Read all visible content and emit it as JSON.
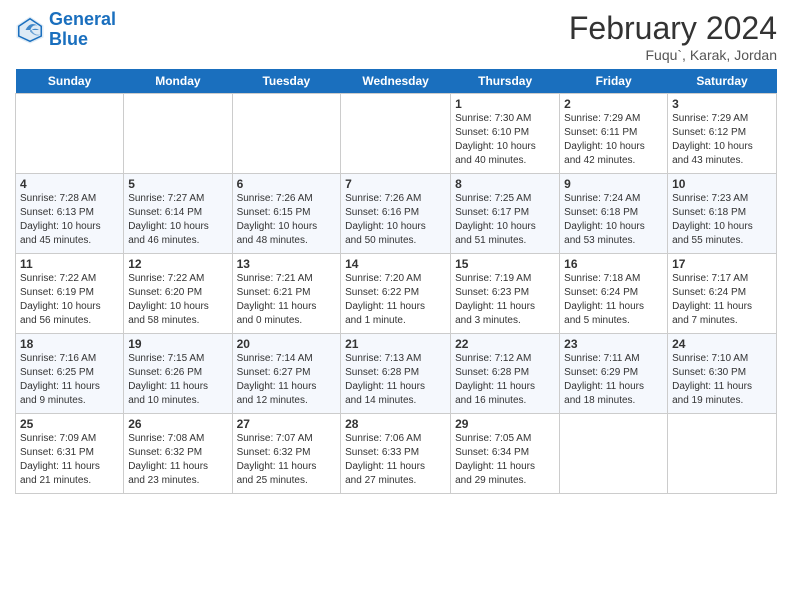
{
  "logo": {
    "line1": "General",
    "line2": "Blue"
  },
  "title": "February 2024",
  "location": "Fuqu`, Karak, Jordan",
  "days_header": [
    "Sunday",
    "Monday",
    "Tuesday",
    "Wednesday",
    "Thursday",
    "Friday",
    "Saturday"
  ],
  "weeks": [
    [
      {
        "day": "",
        "info": ""
      },
      {
        "day": "",
        "info": ""
      },
      {
        "day": "",
        "info": ""
      },
      {
        "day": "",
        "info": ""
      },
      {
        "day": "1",
        "info": "Sunrise: 7:30 AM\nSunset: 6:10 PM\nDaylight: 10 hours\nand 40 minutes."
      },
      {
        "day": "2",
        "info": "Sunrise: 7:29 AM\nSunset: 6:11 PM\nDaylight: 10 hours\nand 42 minutes."
      },
      {
        "day": "3",
        "info": "Sunrise: 7:29 AM\nSunset: 6:12 PM\nDaylight: 10 hours\nand 43 minutes."
      }
    ],
    [
      {
        "day": "4",
        "info": "Sunrise: 7:28 AM\nSunset: 6:13 PM\nDaylight: 10 hours\nand 45 minutes."
      },
      {
        "day": "5",
        "info": "Sunrise: 7:27 AM\nSunset: 6:14 PM\nDaylight: 10 hours\nand 46 minutes."
      },
      {
        "day": "6",
        "info": "Sunrise: 7:26 AM\nSunset: 6:15 PM\nDaylight: 10 hours\nand 48 minutes."
      },
      {
        "day": "7",
        "info": "Sunrise: 7:26 AM\nSunset: 6:16 PM\nDaylight: 10 hours\nand 50 minutes."
      },
      {
        "day": "8",
        "info": "Sunrise: 7:25 AM\nSunset: 6:17 PM\nDaylight: 10 hours\nand 51 minutes."
      },
      {
        "day": "9",
        "info": "Sunrise: 7:24 AM\nSunset: 6:18 PM\nDaylight: 10 hours\nand 53 minutes."
      },
      {
        "day": "10",
        "info": "Sunrise: 7:23 AM\nSunset: 6:18 PM\nDaylight: 10 hours\nand 55 minutes."
      }
    ],
    [
      {
        "day": "11",
        "info": "Sunrise: 7:22 AM\nSunset: 6:19 PM\nDaylight: 10 hours\nand 56 minutes."
      },
      {
        "day": "12",
        "info": "Sunrise: 7:22 AM\nSunset: 6:20 PM\nDaylight: 10 hours\nand 58 minutes."
      },
      {
        "day": "13",
        "info": "Sunrise: 7:21 AM\nSunset: 6:21 PM\nDaylight: 11 hours\nand 0 minutes."
      },
      {
        "day": "14",
        "info": "Sunrise: 7:20 AM\nSunset: 6:22 PM\nDaylight: 11 hours\nand 1 minute."
      },
      {
        "day": "15",
        "info": "Sunrise: 7:19 AM\nSunset: 6:23 PM\nDaylight: 11 hours\nand 3 minutes."
      },
      {
        "day": "16",
        "info": "Sunrise: 7:18 AM\nSunset: 6:24 PM\nDaylight: 11 hours\nand 5 minutes."
      },
      {
        "day": "17",
        "info": "Sunrise: 7:17 AM\nSunset: 6:24 PM\nDaylight: 11 hours\nand 7 minutes."
      }
    ],
    [
      {
        "day": "18",
        "info": "Sunrise: 7:16 AM\nSunset: 6:25 PM\nDaylight: 11 hours\nand 9 minutes."
      },
      {
        "day": "19",
        "info": "Sunrise: 7:15 AM\nSunset: 6:26 PM\nDaylight: 11 hours\nand 10 minutes."
      },
      {
        "day": "20",
        "info": "Sunrise: 7:14 AM\nSunset: 6:27 PM\nDaylight: 11 hours\nand 12 minutes."
      },
      {
        "day": "21",
        "info": "Sunrise: 7:13 AM\nSunset: 6:28 PM\nDaylight: 11 hours\nand 14 minutes."
      },
      {
        "day": "22",
        "info": "Sunrise: 7:12 AM\nSunset: 6:28 PM\nDaylight: 11 hours\nand 16 minutes."
      },
      {
        "day": "23",
        "info": "Sunrise: 7:11 AM\nSunset: 6:29 PM\nDaylight: 11 hours\nand 18 minutes."
      },
      {
        "day": "24",
        "info": "Sunrise: 7:10 AM\nSunset: 6:30 PM\nDaylight: 11 hours\nand 19 minutes."
      }
    ],
    [
      {
        "day": "25",
        "info": "Sunrise: 7:09 AM\nSunset: 6:31 PM\nDaylight: 11 hours\nand 21 minutes."
      },
      {
        "day": "26",
        "info": "Sunrise: 7:08 AM\nSunset: 6:32 PM\nDaylight: 11 hours\nand 23 minutes."
      },
      {
        "day": "27",
        "info": "Sunrise: 7:07 AM\nSunset: 6:32 PM\nDaylight: 11 hours\nand 25 minutes."
      },
      {
        "day": "28",
        "info": "Sunrise: 7:06 AM\nSunset: 6:33 PM\nDaylight: 11 hours\nand 27 minutes."
      },
      {
        "day": "29",
        "info": "Sunrise: 7:05 AM\nSunset: 6:34 PM\nDaylight: 11 hours\nand 29 minutes."
      },
      {
        "day": "",
        "info": ""
      },
      {
        "day": "",
        "info": ""
      }
    ]
  ]
}
